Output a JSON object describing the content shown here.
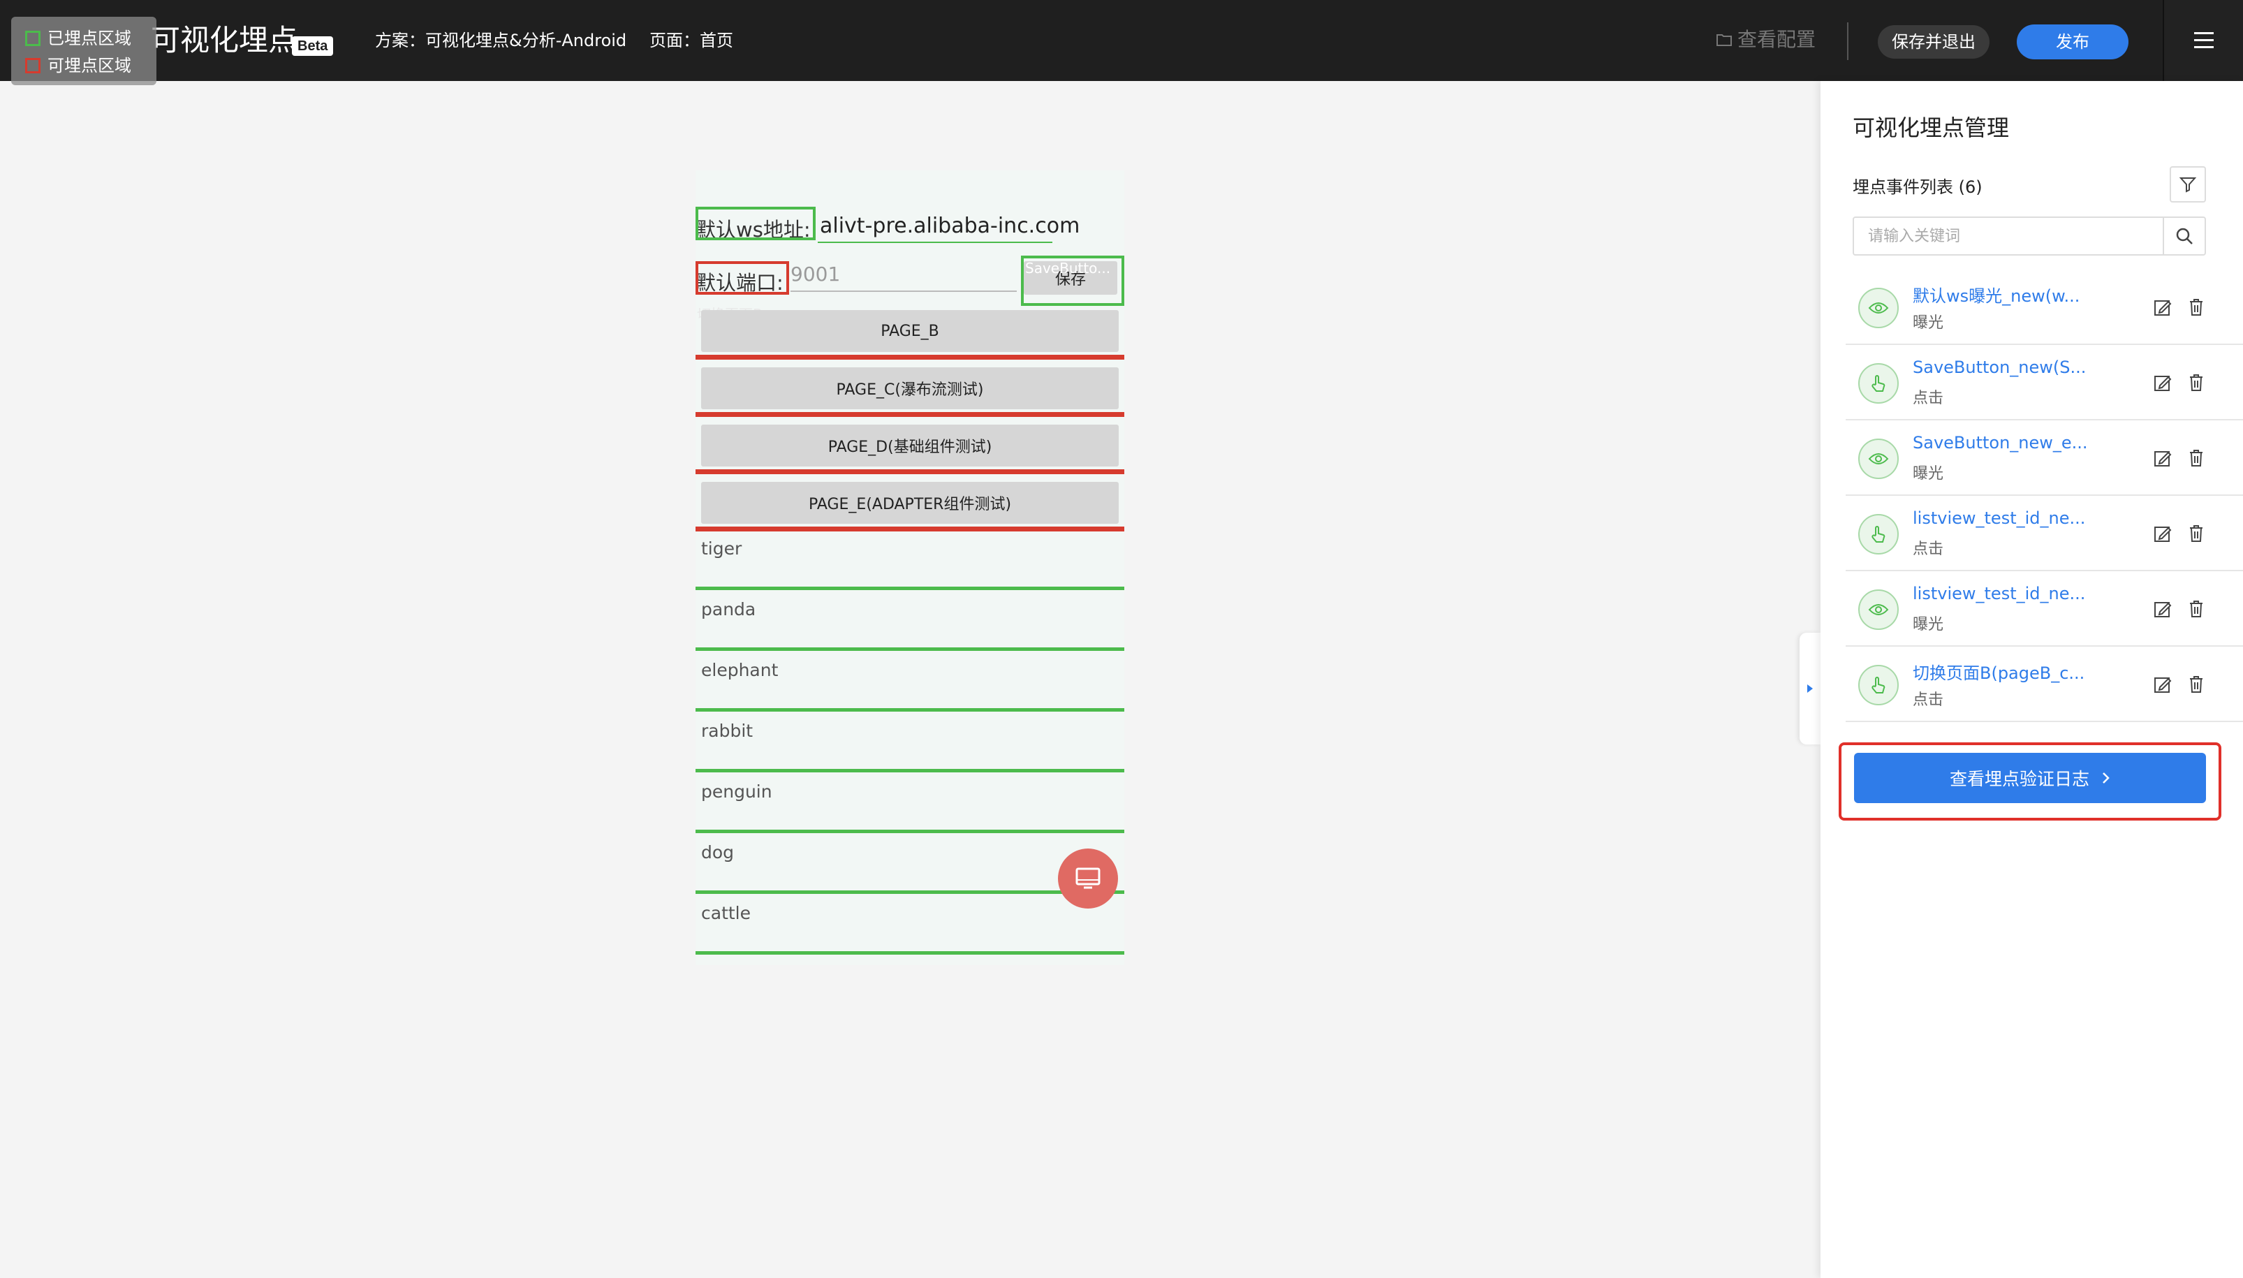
{
  "legend": {
    "tracked_label": "已埋点区域",
    "trackable_label": "可埋点区域",
    "tracked_color": "#4cbb4c",
    "trackable_color": "#d63b2e"
  },
  "header": {
    "brand": "可视化埋点",
    "beta": "Beta",
    "scheme": "方案：可视化埋点&分析-Android",
    "page": "页面：首页",
    "view_config": "查看配置",
    "save_exit": "保存并退出",
    "publish": "发布"
  },
  "phone": {
    "ws_label": "默认ws地址:",
    "ws_value": "alivt-pre.alibaba-inc.com",
    "port_label": "默认端口:",
    "port_value": "9001",
    "save_btn": "保存",
    "save_ghost": "SaveButto...",
    "switch_ghost": "切换页面B",
    "buttons": [
      "PAGE_B",
      "PAGE_C(瀑布流测试)",
      "PAGE_D(基础组件测试)",
      "PAGE_E(ADAPTER组件测试)"
    ],
    "items": [
      "tiger",
      "panda",
      "elephant",
      "rabbit",
      "penguin",
      "dog",
      "cattle"
    ]
  },
  "panel": {
    "title": "可视化埋点管理",
    "list_title": "埋点事件列表 (6)",
    "search_placeholder": "请输入关键词",
    "verify_button": "查看埋点验证日志",
    "events": [
      {
        "name": "默认ws曝光_new(w...",
        "type": "曝光",
        "icon": "eye-icon"
      },
      {
        "name": "SaveButton_new(S...",
        "type": "点击",
        "icon": "hand-icon"
      },
      {
        "name": "SaveButton_new_e...",
        "type": "曝光",
        "icon": "eye-icon"
      },
      {
        "name": "listview_test_id_ne...",
        "type": "点击",
        "icon": "hand-icon"
      },
      {
        "name": "listview_test_id_ne...",
        "type": "曝光",
        "icon": "eye-icon"
      },
      {
        "name": "切换页面B(pageB_c...",
        "type": "点击",
        "icon": "hand-icon"
      }
    ]
  },
  "colors": {
    "accent": "#2f7ce9",
    "topbar": "#1f1f1f",
    "highlight_red": "#e0302a"
  }
}
